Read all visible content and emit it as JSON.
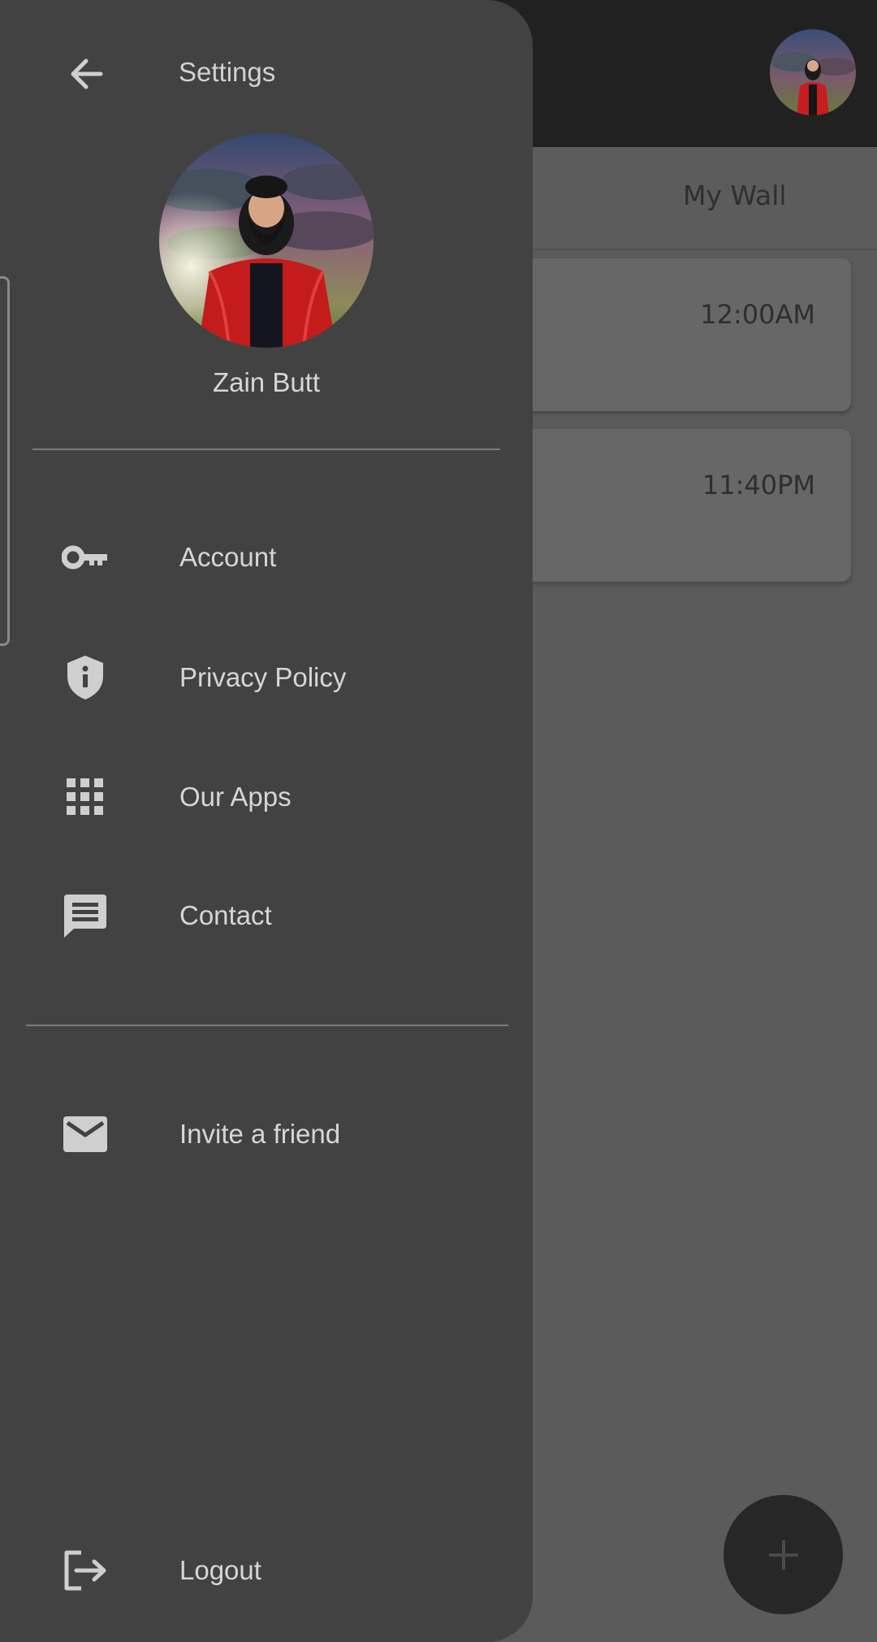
{
  "background": {
    "tab_label": "My Wall",
    "posts": [
      {
        "time": "12:00AM"
      },
      {
        "time": "11:40PM"
      }
    ]
  },
  "drawer": {
    "title": "Settings",
    "user_name": "Zain Butt",
    "menu": [
      {
        "icon": "key-icon",
        "label": "Account"
      },
      {
        "icon": "shield-info-icon",
        "label": "Privacy Policy"
      },
      {
        "icon": "apps-grid-icon",
        "label": "Our Apps"
      },
      {
        "icon": "message-icon",
        "label": "Contact"
      }
    ],
    "secondary_menu": [
      {
        "icon": "mail-icon",
        "label": "Invite a friend"
      }
    ],
    "logout": {
      "icon": "logout-icon",
      "label": "Logout"
    }
  },
  "colors": {
    "drawer_bg": "#424242",
    "scrim_bg": "#5b5b5b",
    "topbar_bg": "#212121",
    "text_primary": "#d6d6d6",
    "icon_color": "#cfcfcf",
    "fab_bg": "#272727"
  }
}
